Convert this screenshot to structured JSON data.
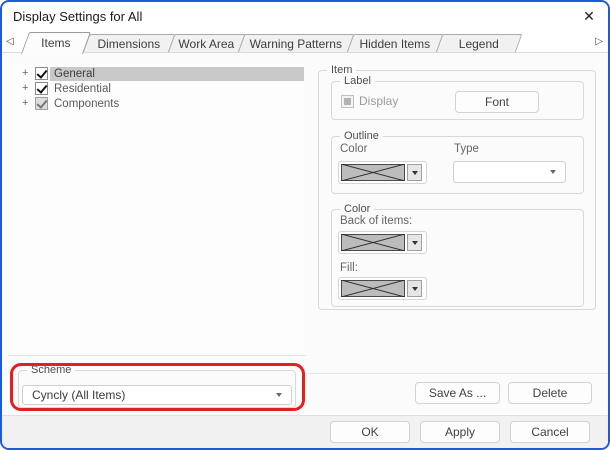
{
  "window": {
    "title": "Display Settings for All"
  },
  "icons": {
    "close": "✕",
    "tab_scroll_left": "◁",
    "tab_scroll_right": "▷",
    "tree_expand": "+"
  },
  "tabs": [
    {
      "label": "Items",
      "active": true
    },
    {
      "label": "Dimensions",
      "active": false
    },
    {
      "label": "Work Area",
      "active": false
    },
    {
      "label": "Warning Patterns",
      "active": false
    },
    {
      "label": "Hidden Items",
      "active": false
    },
    {
      "label": "Legend",
      "active": false
    }
  ],
  "tree": [
    {
      "label": "General",
      "checkbox": "checked",
      "selected": true
    },
    {
      "label": "Residential",
      "checkbox": "checked",
      "selected": false
    },
    {
      "label": "Components",
      "checkbox": "mixed",
      "selected": false
    }
  ],
  "item_panel": {
    "title": "Item",
    "label_group": {
      "title": "Label",
      "display_checkbox_label": "Display",
      "display_checkbox_state": "indeterminate-disabled",
      "font_button": "Font"
    },
    "outline_group": {
      "title": "Outline",
      "color_label": "Color",
      "type_label": "Type",
      "type_value": ""
    },
    "color_group": {
      "title": "Color",
      "back_label": "Back of items:",
      "fill_label": "Fill:"
    }
  },
  "scheme": {
    "title": "Scheme",
    "selected_value": "Cyncly (All Items)"
  },
  "action_buttons": {
    "save_as": "Save As ...",
    "delete": "Delete",
    "ok": "OK",
    "apply": "Apply",
    "cancel": "Cancel"
  },
  "colors": {
    "window_border": "#1e5ad8",
    "annotation_highlight": "#e2201f",
    "tree_selection": "#c9c9c9",
    "swatch_fill": "#bcbcbc"
  }
}
